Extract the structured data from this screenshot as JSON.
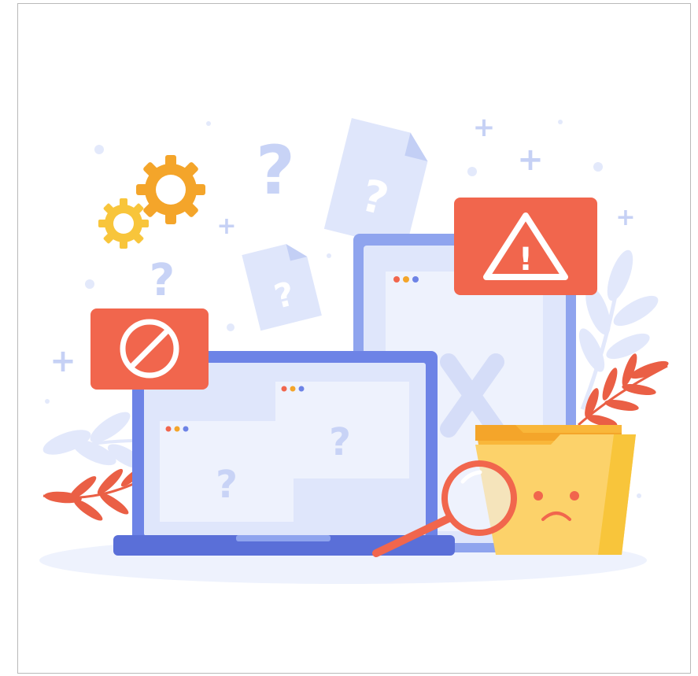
{
  "illustration": {
    "glyphs": {
      "question": "?",
      "plus": "+",
      "exclamation": "!"
    },
    "colors": {
      "background": "#ffffff",
      "frame_border": "#b9b9b9",
      "light_blue": "#dfe6fb",
      "pale_blue": "#eef2fd",
      "blue": "#6d83e6",
      "blue_dark": "#5a6fd8",
      "red": "#f1664d",
      "red_leaf": "#ea5f45",
      "orange": "#f4a52a",
      "gold": "#f8c53b",
      "folder": "#fcd26a",
      "folder_tab": "#f9b73a",
      "window_dot_red": "#f1664d",
      "window_dot_orange": "#f4a52a",
      "window_dot_blue": "#6d83e6"
    },
    "icons": [
      "gear-icon",
      "no-entry-icon",
      "warning-icon",
      "magnifier-icon",
      "sad-folder-icon",
      "document-question-icon",
      "laptop-icon",
      "tablet-icon",
      "leaf-icon"
    ]
  }
}
